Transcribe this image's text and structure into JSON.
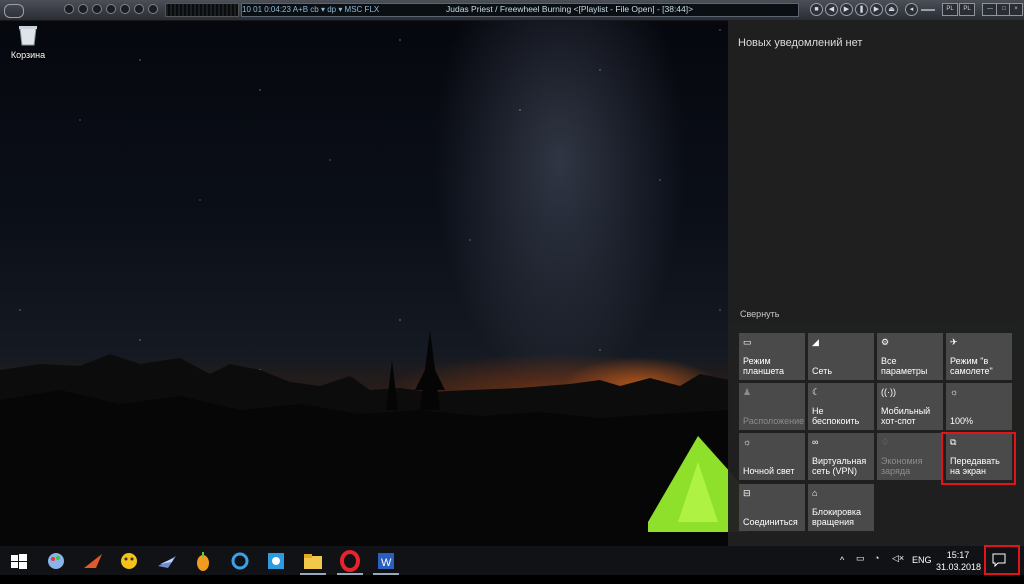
{
  "desktop": {
    "icons": [
      {
        "label": "Корзина",
        "icon": "recycle-bin-icon"
      }
    ]
  },
  "player": {
    "meta_left": "10  01  0:04:23  A+B  cb ▾  dp ▾  MSC  FLX",
    "track_title": "Judas Priest / Freewheel Burning  <[Playlist - File Open] - [38:44]>",
    "sq_buttons": [
      "PL",
      "PL",
      "—",
      "□",
      "×"
    ]
  },
  "action_center": {
    "notifications_text": "Новых уведомлений нет",
    "collapse_label": "Свернуть",
    "tiles": [
      {
        "label": "Режим планшета",
        "icon": "tablet-mode-icon",
        "enabled": true
      },
      {
        "label": "Сеть",
        "icon": "network-icon",
        "enabled": true
      },
      {
        "label": "Все параметры",
        "icon": "settings-icon",
        "enabled": true
      },
      {
        "label": "Режим \"в самолете\"",
        "icon": "airplane-icon",
        "enabled": true
      },
      {
        "label": "Расположение",
        "icon": "location-icon",
        "enabled": false
      },
      {
        "label": "Не беспокоить",
        "icon": "moon-icon",
        "enabled": true
      },
      {
        "label": "Мобильный хот-спот",
        "icon": "hotspot-icon",
        "enabled": true
      },
      {
        "label": "100%",
        "icon": "brightness-icon",
        "enabled": true
      },
      {
        "label": "Ночной свет",
        "icon": "night-light-icon",
        "enabled": true
      },
      {
        "label": "Виртуальная сеть (VPN)",
        "icon": "vpn-icon",
        "enabled": true
      },
      {
        "label": "Экономия заряда",
        "icon": "battery-saver-icon",
        "enabled": false
      },
      {
        "label": "Передавать на экран",
        "icon": "project-icon",
        "enabled": true
      },
      {
        "label": "Соединиться",
        "icon": "connect-icon",
        "enabled": true
      },
      {
        "label": "Блокировка вращения",
        "icon": "rotation-lock-icon",
        "enabled": true
      }
    ]
  },
  "taskbar": {
    "apps": [
      {
        "name": "start",
        "icon": "windows-icon"
      },
      {
        "name": "app-1",
        "icon": "paint-icon"
      },
      {
        "name": "app-2",
        "icon": "bird-icon"
      },
      {
        "name": "app-3",
        "icon": "emoji-icon"
      },
      {
        "name": "app-4",
        "icon": "spaceship-icon"
      },
      {
        "name": "app-5",
        "icon": "fruity-loops-icon"
      },
      {
        "name": "app-6",
        "icon": "refresh-app-icon"
      },
      {
        "name": "app-7",
        "icon": "capture-icon"
      },
      {
        "name": "file-explorer",
        "icon": "folder-icon"
      },
      {
        "name": "opera",
        "icon": "opera-icon"
      },
      {
        "name": "word",
        "icon": "word-icon"
      }
    ],
    "language": "ENG",
    "time": "15:17",
    "date": "31.03.2018"
  },
  "colors": {
    "highlight": "#e2141b",
    "tile": "#4a4a4a",
    "panel": "#202020"
  }
}
